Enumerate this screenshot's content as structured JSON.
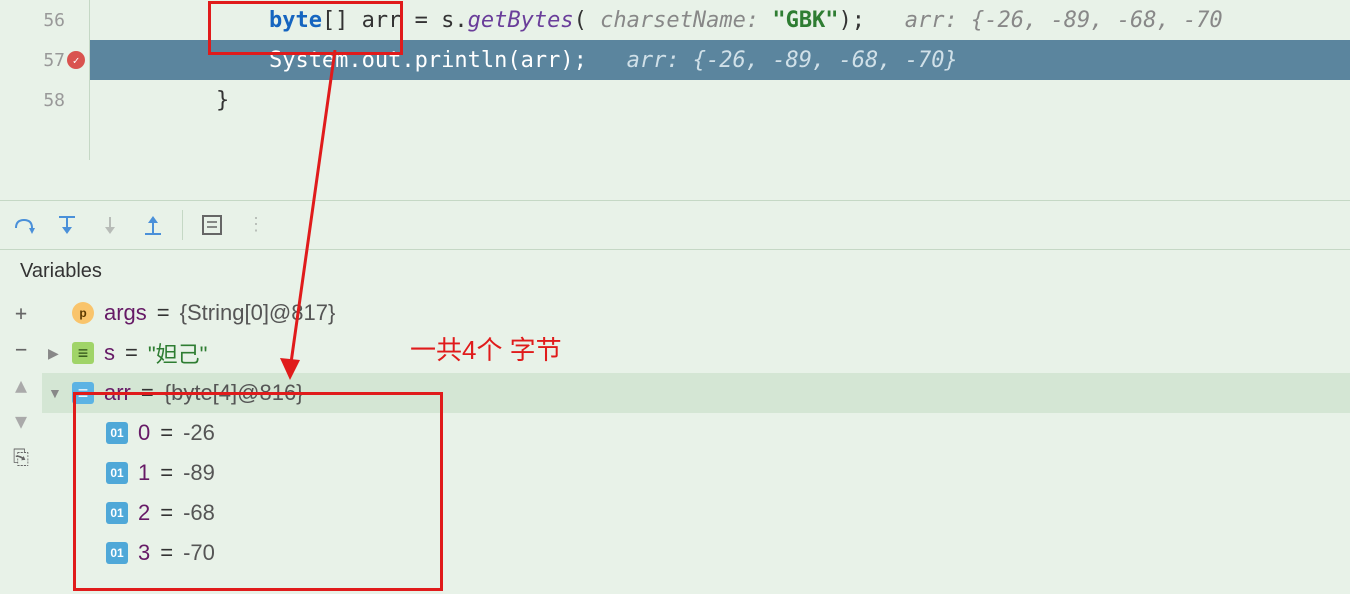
{
  "gutter": {
    "lines": [
      "56",
      "57",
      "58"
    ]
  },
  "code": {
    "line56": {
      "indent": "            ",
      "kw": "byte",
      "brackets": "[]",
      "var": " arr ",
      "mid": "= s.",
      "method": "getBytes",
      "open": "( ",
      "param": "charsetName:",
      "str": " \"GBK\"",
      "close": ");   ",
      "hint": "arr: {-26, -89, -68, -70"
    },
    "line57": {
      "indent": "            ",
      "text": "System.out.println(arr);   ",
      "hint": "arr: {-26, -89, -68, -70}"
    },
    "line58": {
      "indent": "        ",
      "brace": "}"
    }
  },
  "annotation": "一共4个 字节",
  "panel": {
    "title": "Variables"
  },
  "vars": {
    "args": {
      "name": "args",
      "value": "{String[0]@817}"
    },
    "s": {
      "name": "s",
      "value": "\"妲己\""
    },
    "arr": {
      "name": "arr",
      "value": "{byte[4]@816}"
    },
    "items": [
      {
        "idx": "0",
        "val": "-26"
      },
      {
        "idx": "1",
        "val": "-89"
      },
      {
        "idx": "2",
        "val": "-68"
      },
      {
        "idx": "3",
        "val": "-70"
      }
    ]
  }
}
